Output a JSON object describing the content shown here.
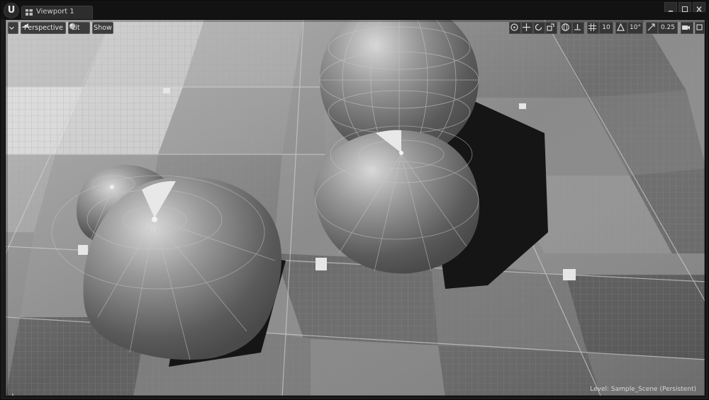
{
  "window": {
    "logo": "U",
    "tab_label": "Viewport 1",
    "tab_icon": "viewport-grid-icon",
    "controls": [
      "minimize-icon",
      "maximize-icon",
      "close-icon"
    ]
  },
  "viewport_toolbar": {
    "options_icon": "chevron-down-icon",
    "perspective_label": "Perspective",
    "lit_label": "Lit",
    "show_label": "Show",
    "grid_snap_value": "10",
    "rotation_snap_value": "10°",
    "scale_snap_value": "0.25",
    "transform_icons": [
      "select-icon",
      "translate-icon",
      "rotate-icon",
      "scale-icon",
      "world-local-icon",
      "surface-snap-icon",
      "grid-snap-icon",
      "angle-snap-icon",
      "scale-snap-icon",
      "camera-speed-icon",
      "maximize-viewport-icon"
    ]
  },
  "status": {
    "level_text": "Level:  Sample_Scene (Persistent)"
  },
  "colors": {
    "panel_bg": "#1b1b1b",
    "floor_light": "#b4b4b4",
    "floor_dark": "#6a6a6a",
    "sphere": "#8e8e8e"
  }
}
